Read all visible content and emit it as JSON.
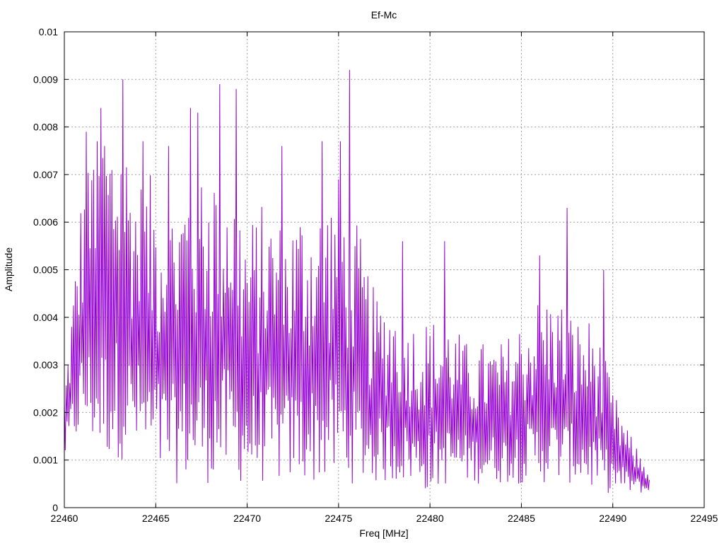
{
  "chart_data": {
    "type": "line",
    "title": "Ef-Mc",
    "xlabel": "Freq [MHz]",
    "ylabel": "Amplitude",
    "xlim": [
      22460,
      22495
    ],
    "ylim": [
      0,
      0.01
    ],
    "x_ticks": [
      22460,
      22465,
      22470,
      22475,
      22480,
      22485,
      22490,
      22495
    ],
    "y_ticks": [
      0,
      0.001,
      0.002,
      0.003,
      0.004,
      0.005,
      0.006,
      0.007,
      0.008,
      0.009,
      0.01
    ],
    "x_tick_labels": [
      "22460",
      "22465",
      "22470",
      "22475",
      "22480",
      "22485",
      "22490",
      "22495"
    ],
    "y_tick_labels": [
      "0",
      "0.001",
      "0.002",
      "0.003",
      "0.004",
      "0.005",
      "0.006",
      "0.007",
      "0.008",
      "0.009",
      "0.01"
    ],
    "grid": true,
    "line_color": "#9400d3",
    "series": [
      {
        "x_start": 22460,
        "x_end": 22492,
        "x_step": 0.05,
        "envelope": [
          {
            "x": 22460.0,
            "low": 0.001,
            "high": 0.0025
          },
          {
            "x": 22461.0,
            "low": 0.0015,
            "high": 0.007
          },
          {
            "x": 22462.0,
            "low": 0.001,
            "high": 0.008
          },
          {
            "x": 22463.0,
            "low": 0.001,
            "high": 0.0085
          },
          {
            "x": 22464.0,
            "low": 0.001,
            "high": 0.007
          },
          {
            "x": 22465.0,
            "low": 0.0005,
            "high": 0.007
          },
          {
            "x": 22466.0,
            "low": 0.0005,
            "high": 0.0065
          },
          {
            "x": 22467.0,
            "low": 0.0005,
            "high": 0.0075
          },
          {
            "x": 22468.0,
            "low": 0.0005,
            "high": 0.0075
          },
          {
            "x": 22469.0,
            "low": 0.0005,
            "high": 0.0075
          },
          {
            "x": 22470.0,
            "low": 0.0005,
            "high": 0.006
          },
          {
            "x": 22471.0,
            "low": 0.0005,
            "high": 0.0065
          },
          {
            "x": 22472.0,
            "low": 0.0005,
            "high": 0.006
          },
          {
            "x": 22473.0,
            "low": 0.0005,
            "high": 0.0065
          },
          {
            "x": 22474.0,
            "low": 0.0005,
            "high": 0.0065
          },
          {
            "x": 22475.0,
            "low": 0.0005,
            "high": 0.007
          },
          {
            "x": 22476.0,
            "low": 0.0005,
            "high": 0.006
          },
          {
            "x": 22477.0,
            "low": 0.0005,
            "high": 0.0045
          },
          {
            "x": 22478.0,
            "low": 0.0005,
            "high": 0.0045
          },
          {
            "x": 22479.0,
            "low": 0.0005,
            "high": 0.004
          },
          {
            "x": 22480.0,
            "low": 0.0003,
            "high": 0.004
          },
          {
            "x": 22481.0,
            "low": 0.0005,
            "high": 0.004
          },
          {
            "x": 22482.0,
            "low": 0.0005,
            "high": 0.0035
          },
          {
            "x": 22483.0,
            "low": 0.0005,
            "high": 0.0035
          },
          {
            "x": 22484.0,
            "low": 0.0005,
            "high": 0.0035
          },
          {
            "x": 22485.0,
            "low": 0.0005,
            "high": 0.004
          },
          {
            "x": 22486.0,
            "low": 0.0005,
            "high": 0.0045
          },
          {
            "x": 22487.0,
            "low": 0.0005,
            "high": 0.0045
          },
          {
            "x": 22488.0,
            "low": 0.0005,
            "high": 0.004
          },
          {
            "x": 22489.0,
            "low": 0.0003,
            "high": 0.004
          },
          {
            "x": 22490.0,
            "low": 0.0003,
            "high": 0.0025
          },
          {
            "x": 22491.0,
            "low": 0.0003,
            "high": 0.0015
          },
          {
            "x": 22492.0,
            "low": 0.0003,
            "high": 0.0008
          }
        ],
        "peaks": [
          {
            "x": 22461.2,
            "y": 0.0079
          },
          {
            "x": 22461.6,
            "y": 0.0071
          },
          {
            "x": 22462.0,
            "y": 0.0084
          },
          {
            "x": 22462.2,
            "y": 0.0076
          },
          {
            "x": 22463.2,
            "y": 0.009
          },
          {
            "x": 22464.3,
            "y": 0.0077
          },
          {
            "x": 22465.7,
            "y": 0.0076
          },
          {
            "x": 22466.9,
            "y": 0.0084
          },
          {
            "x": 22467.3,
            "y": 0.0083
          },
          {
            "x": 22468.5,
            "y": 0.0089
          },
          {
            "x": 22469.4,
            "y": 0.0088
          },
          {
            "x": 22471.9,
            "y": 0.0076
          },
          {
            "x": 22474.1,
            "y": 0.0077
          },
          {
            "x": 22475.1,
            "y": 0.0077
          },
          {
            "x": 22475.6,
            "y": 0.0092
          },
          {
            "x": 22478.5,
            "y": 0.0056
          },
          {
            "x": 22480.8,
            "y": 0.0056
          },
          {
            "x": 22486.0,
            "y": 0.0053
          },
          {
            "x": 22487.5,
            "y": 0.0063
          },
          {
            "x": 22489.5,
            "y": 0.005
          }
        ]
      }
    ]
  }
}
